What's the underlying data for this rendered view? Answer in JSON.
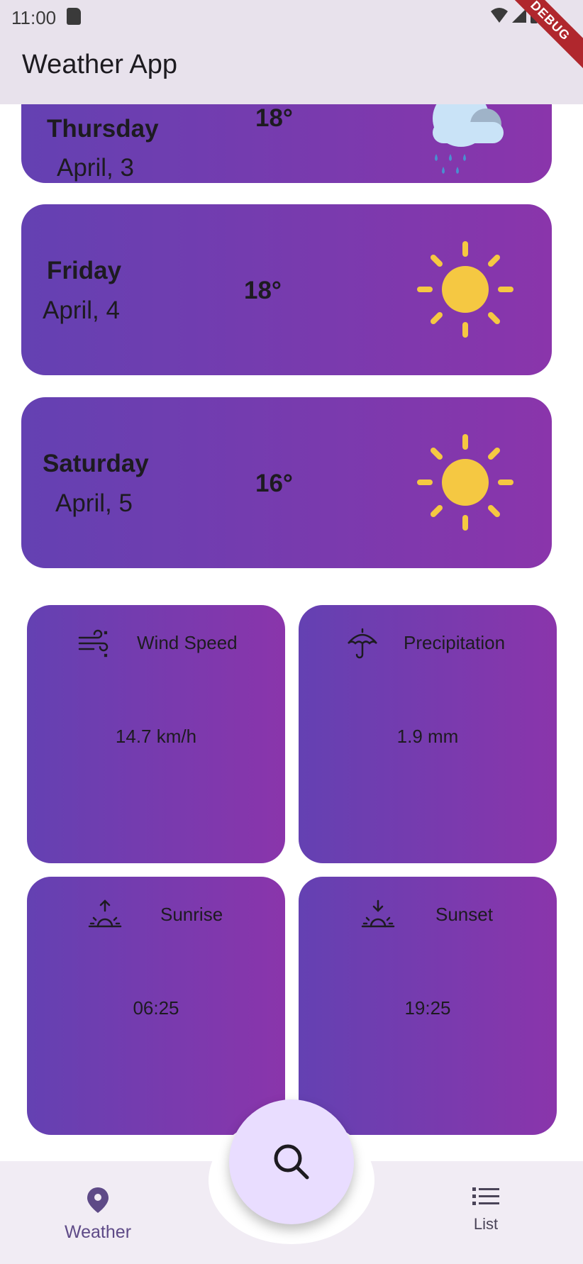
{
  "status_bar": {
    "time": "11:00"
  },
  "app_bar": {
    "title": "Weather App",
    "debug_label": "DEBUG"
  },
  "forecast": [
    {
      "day": "Thursday",
      "date": "April, 3",
      "temp": "18°",
      "icon": "rain-cloud-icon"
    },
    {
      "day": "Friday",
      "date": "April, 4",
      "temp": "18°",
      "icon": "sun-icon"
    },
    {
      "day": "Saturday",
      "date": "April, 5",
      "temp": "16°",
      "icon": "sun-icon"
    }
  ],
  "stats": {
    "wind": {
      "label": "Wind Speed",
      "value": "14.7 km/h",
      "icon": "wind-icon"
    },
    "precipitation": {
      "label": "Precipitation",
      "value": "1.9 mm",
      "icon": "umbrella-icon"
    },
    "sunrise": {
      "label": "Sunrise",
      "value": "06:25",
      "icon": "sunrise-icon"
    },
    "sunset": {
      "label": "Sunset",
      "value": "19:25",
      "icon": "sunset-icon"
    }
  },
  "bottom_nav": {
    "weather_label": "Weather",
    "list_label": "List",
    "search_icon": "search-icon"
  },
  "colors": {
    "card_gradient_start": "#6441b2",
    "card_gradient_end": "#8a35ab",
    "sun": "#f5c842",
    "nav_active": "#5e4a87",
    "fab": "#e9ddff"
  }
}
